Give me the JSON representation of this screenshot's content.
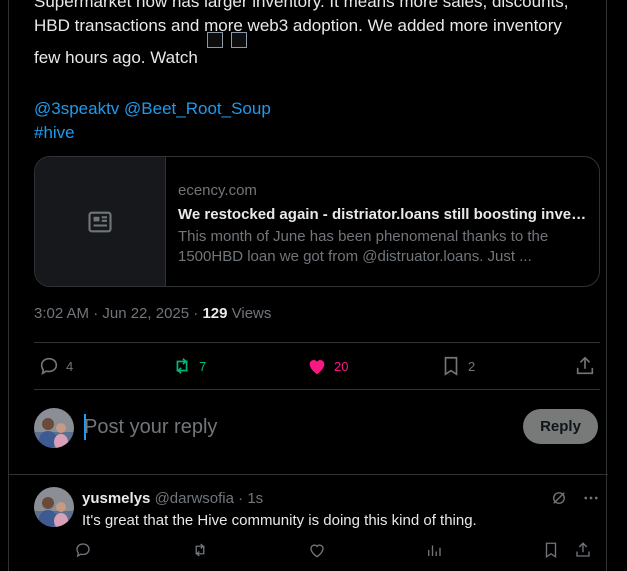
{
  "tweet": {
    "line1": "Supermarket now has larger inventory. It means more sales, discounts,",
    "line2": "HBD transactions and more web3 adoption. We added more inventory",
    "line3": "few hours ago. Watch",
    "mention1": "@3speaktv",
    "mention2": "@Beet_Root_Soup",
    "hashtag": "#hive"
  },
  "card": {
    "domain": "ecency.com",
    "title": "We restocked again - distriator.loans still boosting invento...",
    "desc_line1": "This month of June has been phenomenal thanks to the",
    "desc_line2": "1500HBD loan we got from @distruator.loans. Just ..."
  },
  "meta": {
    "time": "3:02 AM · Jun 22, 2025 · ",
    "views_count": "129",
    "views_label": " Views"
  },
  "actions": {
    "replies": "4",
    "retweets": "7",
    "likes": "20",
    "bookmarks": "2"
  },
  "reply_box": {
    "placeholder": "Post your reply",
    "button": "Reply"
  },
  "comment": {
    "name": "yusmelys",
    "handle": "@darwsofia · 1s",
    "text": "It's great that the Hive community is doing this kind of thing."
  },
  "colors": {
    "accent": "#1d9bf0",
    "like": "#f91880",
    "retweet": "#00ba7c"
  }
}
